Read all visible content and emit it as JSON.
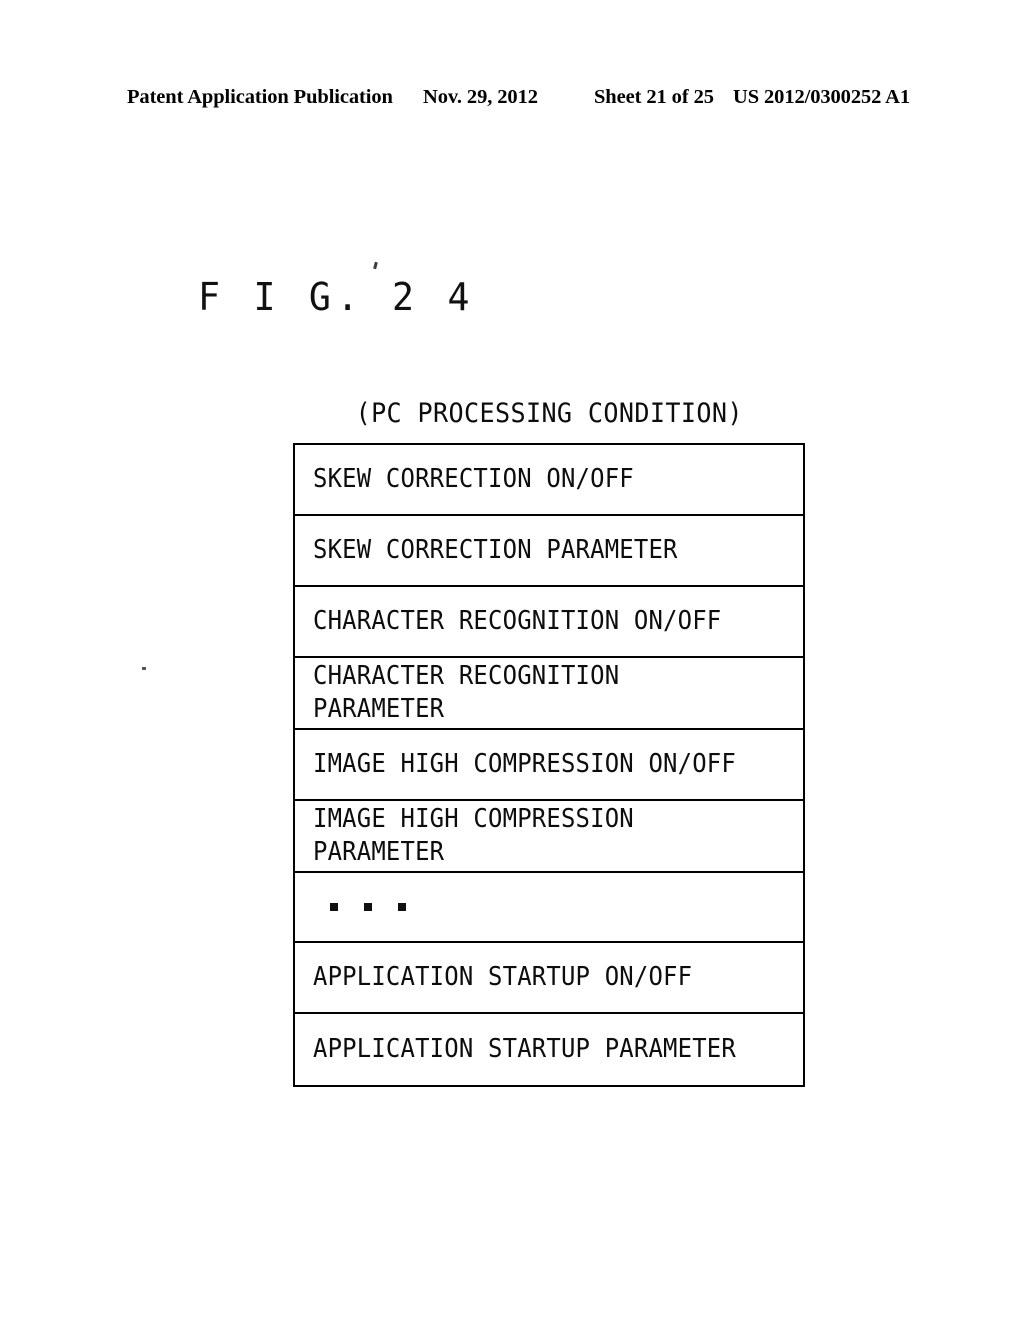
{
  "header": {
    "publication": "Patent Application Publication",
    "date": "Nov. 29, 2012",
    "sheet": "Sheet 21 of 25",
    "patent_number": "US 2012/0300252 A1"
  },
  "figure": {
    "label": "F I G. 2 4",
    "caption": "(PC PROCESSING CONDITION)"
  },
  "table": {
    "rows": [
      {
        "text": "SKEW CORRECTION ON/OFF",
        "type": "single"
      },
      {
        "text": "SKEW CORRECTION PARAMETER",
        "type": "single"
      },
      {
        "text": "CHARACTER RECOGNITION ON/OFF",
        "type": "single"
      },
      {
        "text": "CHARACTER RECOGNITION\nPARAMETER",
        "type": "double"
      },
      {
        "text": "IMAGE HIGH COMPRESSION ON/OFF",
        "type": "single"
      },
      {
        "text": "IMAGE HIGH COMPRESSION\nPARAMETER",
        "type": "double"
      },
      {
        "text": "",
        "type": "ellipsis"
      },
      {
        "text": "APPLICATION STARTUP ON/OFF",
        "type": "single"
      },
      {
        "text": "APPLICATION STARTUP PARAMETER",
        "type": "single"
      }
    ]
  },
  "colors": {
    "ink": "#000000",
    "paper": "#ffffff"
  }
}
